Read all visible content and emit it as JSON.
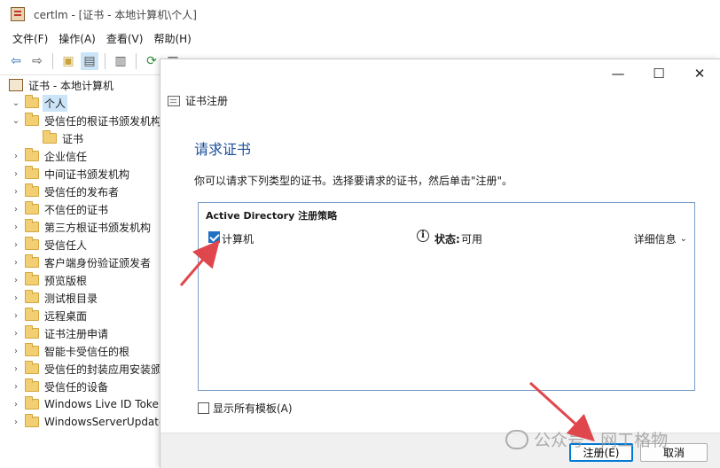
{
  "window": {
    "title": "certlm - [证书 - 本地计算机\\个人]"
  },
  "menu": [
    "文件(F)",
    "操作(A)",
    "查看(V)",
    "帮助(H)"
  ],
  "toolbar_icons": [
    "back-arrow-icon",
    "forward-arrow-icon",
    "up-folder-icon",
    "show-tree-icon",
    "properties-icon",
    "refresh-icon",
    "export-icon",
    "help-icon",
    "console-icon"
  ],
  "tree": {
    "root": "证书 - 本地计算机",
    "items": [
      {
        "label": "个人",
        "expanded": true,
        "selected": true
      },
      {
        "label": "受信任的根证书颁发机构",
        "expanded": true
      },
      {
        "label": "证书",
        "child": true
      },
      {
        "label": "企业信任"
      },
      {
        "label": "中间证书颁发机构"
      },
      {
        "label": "受信任的发布者"
      },
      {
        "label": "不信任的证书"
      },
      {
        "label": "第三方根证书颁发机构"
      },
      {
        "label": "受信任人"
      },
      {
        "label": "客户端身份验证颁发者"
      },
      {
        "label": "预览版根"
      },
      {
        "label": "测试根目录"
      },
      {
        "label": "远程桌面"
      },
      {
        "label": "证书注册申请"
      },
      {
        "label": "智能卡受信任的根"
      },
      {
        "label": "受信任的封装应用安装颁"
      },
      {
        "label": "受信任的设备"
      },
      {
        "label": "Windows Live ID Toke"
      },
      {
        "label": "WindowsServerUpdate"
      }
    ]
  },
  "dialog": {
    "window_controls": [
      "—",
      "☐",
      "✕"
    ],
    "header": "证书注册",
    "heading": "请求证书",
    "intro": "你可以请求下列类型的证书。选择要请求的证书，然后单击\"注册\"。",
    "policy": {
      "title": "Active Directory 注册策略",
      "rows": [
        {
          "name": "计算机",
          "checked": true,
          "status_label": "状态:",
          "status_value": "可用",
          "details": "详细信息"
        }
      ]
    },
    "show_all_label": "显示所有模板(A)",
    "show_all_checked": false,
    "buttons": {
      "enroll": "注册(E)",
      "cancel": "取消"
    }
  },
  "watermark": "公众号 · 网工格物",
  "annotation_color": "#e0474c"
}
